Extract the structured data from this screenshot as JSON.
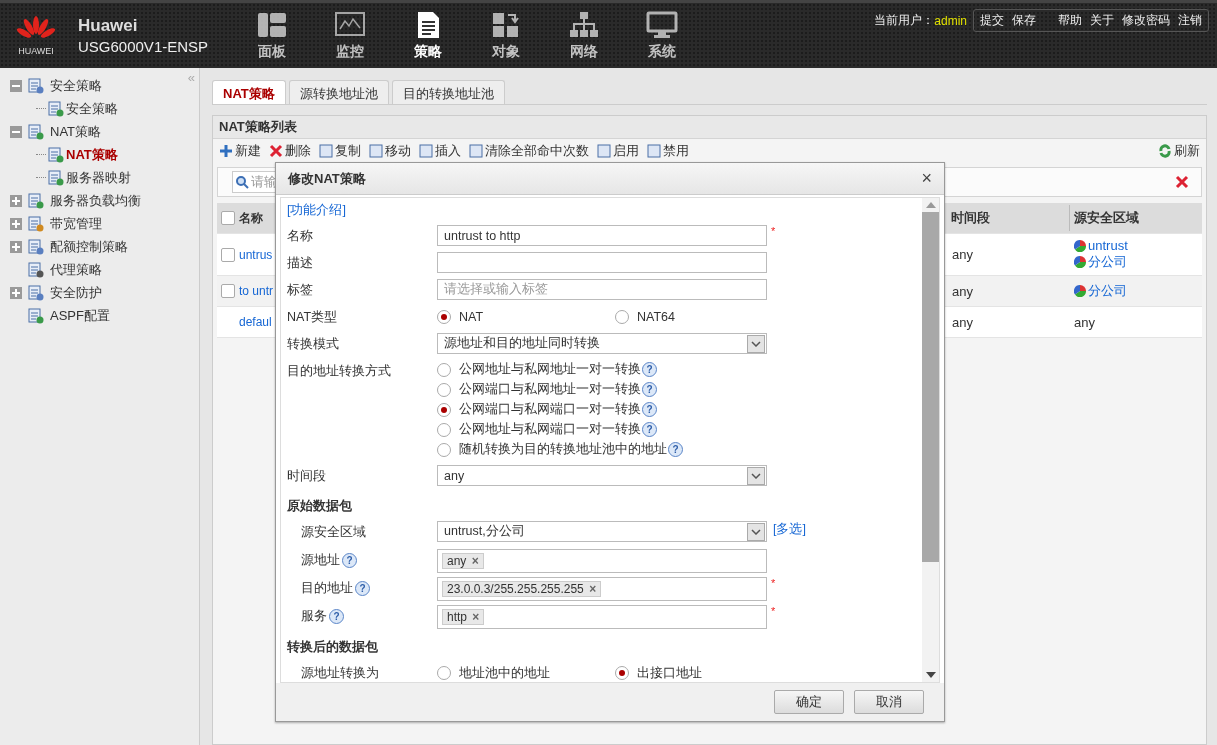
{
  "header": {
    "logo_text": "HUAWEI",
    "brand": "Huawei",
    "model": "USG6000V1-ENSP",
    "nav": [
      {
        "label": "面板",
        "selected": false
      },
      {
        "label": "监控",
        "selected": false
      },
      {
        "label": "策略",
        "selected": true
      },
      {
        "label": "对象",
        "selected": false
      },
      {
        "label": "网络",
        "selected": false
      },
      {
        "label": "系统",
        "selected": false
      }
    ],
    "user_label": "当前用户：",
    "user": "admin",
    "links": [
      "提交",
      "保存",
      "帮助",
      "关于",
      "修改密码",
      "注销"
    ]
  },
  "sidebar": {
    "collapse": "«",
    "items": [
      {
        "kind": "group",
        "label": "安全策略",
        "expanded": true,
        "children": [
          {
            "label": "安全策略",
            "selected": false
          }
        ]
      },
      {
        "kind": "group",
        "label": "NAT策略",
        "expanded": true,
        "children": [
          {
            "label": "NAT策略",
            "selected": true
          },
          {
            "label": "服务器映射",
            "selected": false
          }
        ]
      },
      {
        "kind": "group",
        "label": "服务器负载均衡",
        "expanded": false
      },
      {
        "kind": "group",
        "label": "带宽管理",
        "expanded": false
      },
      {
        "kind": "group",
        "label": "配额控制策略",
        "expanded": false
      },
      {
        "kind": "leaf",
        "label": "代理策略"
      },
      {
        "kind": "group",
        "label": "安全防护",
        "expanded": false
      },
      {
        "kind": "leaf",
        "label": "ASPF配置"
      }
    ]
  },
  "tabs": [
    {
      "label": "NAT策略",
      "selected": true
    },
    {
      "label": "源转换地址池",
      "selected": false
    },
    {
      "label": "目的转换地址池",
      "selected": false
    }
  ],
  "panel": {
    "title": "NAT策略列表",
    "toolbar": [
      "新建",
      "删除",
      "复制",
      "移动",
      "插入",
      "清除全部命中次数",
      "启用",
      "禁用"
    ],
    "refresh": "刷新",
    "search_placeholder": "请输",
    "columns": [
      "名称",
      "时间段",
      "源安全区域"
    ],
    "select_all_checked": false,
    "rows": [
      {
        "kind": "rule",
        "checked": false,
        "name": "untrus",
        "time": "any",
        "zones": [
          {
            "kind": "zone",
            "label": "untrust"
          },
          {
            "kind": "zone",
            "label": "分公司"
          }
        ]
      },
      {
        "kind": "rule",
        "checked": false,
        "name": "to untr",
        "time": "any",
        "zones": [
          {
            "kind": "zone",
            "label": "分公司"
          }
        ]
      },
      {
        "kind": "default",
        "name": "defaul",
        "time": "any",
        "zones": [
          {
            "kind": "text",
            "label": "any"
          }
        ]
      }
    ]
  },
  "dialog": {
    "title": "修改NAT策略",
    "close": "×",
    "intro": "[功能介绍]",
    "fields": [
      {
        "kind": "text",
        "label": "名称",
        "value": "untrust to http",
        "required_mark": "*"
      },
      {
        "kind": "text",
        "label": "描述"
      },
      {
        "kind": "text",
        "label": "标签",
        "placeholder": "请选择或输入标签"
      },
      {
        "kind": "radio",
        "label": "NAT类型",
        "options": [
          {
            "label": "NAT",
            "selected": true
          },
          {
            "label": "NAT64",
            "selected": false
          }
        ]
      },
      {
        "kind": "select",
        "label": "转换模式",
        "value": "源地址和目的地址同时转换"
      },
      {
        "kind": "radiolist",
        "label": "目的地址转换方式",
        "options": [
          {
            "label": "公网地址与私网地址一对一转换",
            "selected": false,
            "help": "?"
          },
          {
            "label": "公网端口与私网地址一对一转换",
            "selected": false,
            "help": "?"
          },
          {
            "label": "公网端口与私网端口一对一转换",
            "selected": true,
            "help": "?"
          },
          {
            "label": "公网地址与私网端口一对一转换",
            "selected": false,
            "help": "?"
          },
          {
            "label": "随机转换为目的转换地址池中的地址",
            "selected": false,
            "help": "?"
          }
        ]
      },
      {
        "kind": "select",
        "label": "时间段",
        "value": "any"
      },
      {
        "kind": "section",
        "label": "原始数据包",
        "fields": [
          {
            "kind": "select",
            "label": "源安全区域",
            "value": "untrust,分公司",
            "link": "[多选]"
          },
          {
            "kind": "tags",
            "label": "源地址",
            "help": "?",
            "tags": [
              {
                "label": "any",
                "remove": "×"
              }
            ]
          },
          {
            "kind": "tags",
            "label": "目的地址",
            "help": "?",
            "tags": [
              {
                "label": "23.0.0.3/255.255.255.255",
                "remove": "×"
              }
            ],
            "required_mark": "*"
          },
          {
            "kind": "tags",
            "label": "服务",
            "help": "?",
            "tags": [
              {
                "label": "http",
                "remove": "×"
              }
            ],
            "required_mark": "*"
          }
        ]
      },
      {
        "kind": "section",
        "label": "转换后的数据包",
        "fields": [
          {
            "kind": "radio",
            "label": "源地址转换为",
            "options": [
              {
                "label": "地址池中的地址",
                "selected": false
              },
              {
                "label": "出接口地址",
                "selected": true
              }
            ]
          }
        ]
      }
    ],
    "buttons": [
      "确定",
      "取消"
    ]
  }
}
